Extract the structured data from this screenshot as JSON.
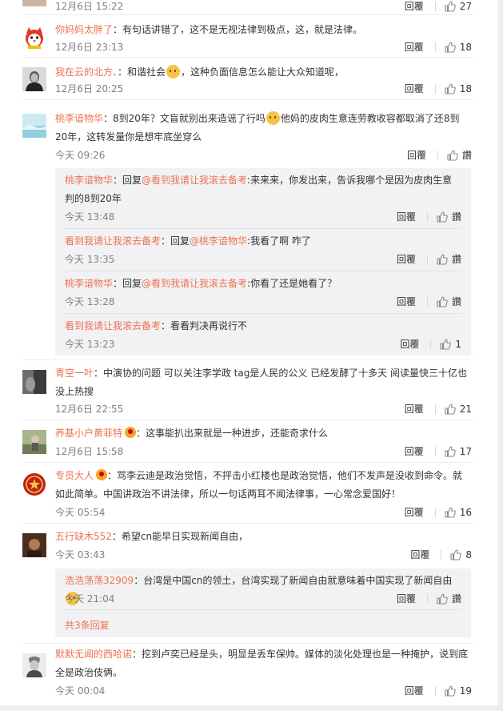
{
  "actions": {
    "reply": "回覆"
  },
  "top": {
    "time": "12月6日 15:22",
    "likes": "27"
  },
  "comments": [
    {
      "user": "你妈妈太胖了",
      "text": "：有句话讲错了，这不是无视法律到极点，这，就是法律。",
      "time": "12月6日 23:13",
      "likes": "18",
      "avatar": "cartoon-avatar"
    },
    {
      "user": "我在云的北方、",
      "text_a": "：和谐社会",
      "text_b": "，这种负面信息怎么能让大众知道呢，",
      "time": "12月6日 20:25",
      "likes": "18",
      "avatar": "portrait-avatar"
    },
    {
      "user": "桃李谙物华",
      "text_a": "：8到20年？文盲就别出来造谣了行吗",
      "text_b": "他妈的皮肉生意连劳教收容都取消了还8到20年，这转发量你是想牢底坐穿么",
      "time": "今天 09:26",
      "likes": "讚",
      "avatar": "landscape-avatar",
      "replies": [
        {
          "user": "桃李谙物华",
          "prefix": "：回复",
          "target": "@看到我请让我滚去备考",
          "text": ":来来来，你发出来，告诉我哪个是因为皮肉生意判的8到20年",
          "time": "今天 13:48",
          "likes": "讚"
        },
        {
          "user": "看到我请让我滚去备考",
          "prefix": "：回复",
          "target": "@桃李谙物华",
          "text": ":我看了啊 咋了",
          "time": "今天 13:35",
          "likes": "讚"
        },
        {
          "user": "桃李谙物华",
          "prefix": "：回复",
          "target": "@看到我请让我滚去备考",
          "text": ":你看了还是她看了？",
          "time": "今天 13:28",
          "likes": "讚"
        },
        {
          "user": "看到我请让我滚去备考",
          "text": "：看看判决再说行不",
          "time": "今天 13:23",
          "likes": "1"
        }
      ]
    },
    {
      "user": "青空一叶",
      "text": "：中演协的问题 可以关注李学政 tag是人民的公义 已经发酵了十多天 阅读量快三十亿也没上热搜",
      "time": "12月6日 22:55",
      "likes": "21",
      "avatar": "dark-photo-avatar"
    },
    {
      "user": "养基小户黄菲特",
      "text": "：这事能扒出来就是一种进步，还能奇求什么",
      "time": "12月6日 15:58",
      "likes": "17",
      "avatar": "outdoor-avatar"
    },
    {
      "user": "专员大人",
      "text": "：骂李云迪是政治觉悟，不抨击小红楼也是政治觉悟，他们不发声是没收到命令。就如此简单。中国讲政治不讲法律，所以一句话两耳不闻法律事，一心常念爱国好！",
      "time": "今天 05:54",
      "likes": "16",
      "avatar": "emblem-avatar"
    },
    {
      "user": "五行缺木552",
      "text": "：希望cn能早日实现新闻自由，",
      "time": "今天 03:43",
      "likes": "8",
      "avatar": "brown-avatar",
      "replies": [
        {
          "user": "浩浩荡荡32909",
          "text": "：台湾是中国cn的领土，台湾实现了新闻自由就意味着中国实现了新闻自由",
          "time": "今天 21:04",
          "likes": "讚"
        }
      ],
      "more": "共3条回复"
    },
    {
      "user": "默默无闻的西哈诺",
      "text": "：挖到卢奕已经是头，明显是丢车保帅。媒体的淡化处理也是一种掩护，说到底全是政治伎俩。",
      "time": "今天 00:04",
      "likes": "19",
      "avatar": "sketch-avatar"
    }
  ]
}
